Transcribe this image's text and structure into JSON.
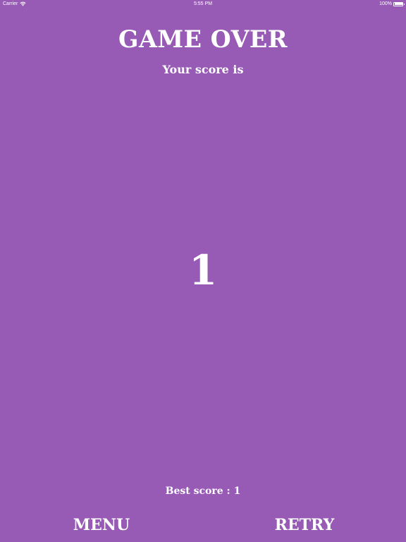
{
  "status_bar": {
    "carrier": "Carrier",
    "time": "5:55 PM",
    "battery": "100%",
    "battery_level": 1.0,
    "wifi_icon": "wifi-icon",
    "battery_icon": "battery-icon"
  },
  "game_over": {
    "title": "GAME OVER",
    "subtitle": "Your score is",
    "score": "1",
    "best_score": "Best score : 1"
  },
  "buttons": {
    "menu": "MENU",
    "retry": "RETRY"
  },
  "colors": {
    "background": "#975bb5",
    "text": "#ffffff"
  }
}
